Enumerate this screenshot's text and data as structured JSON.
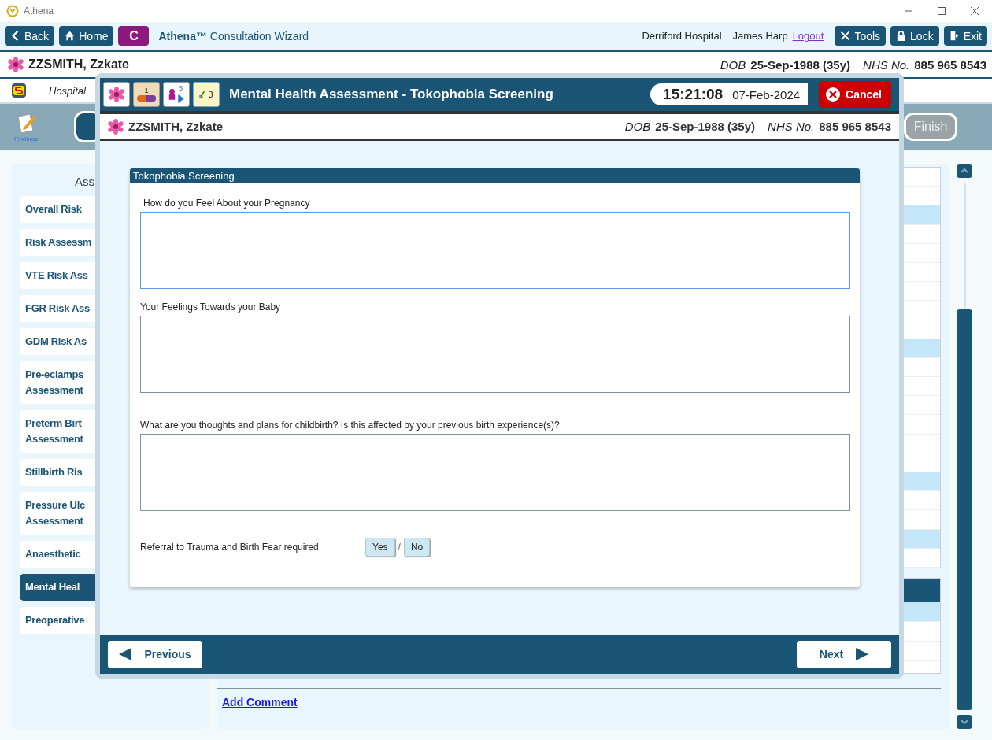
{
  "app": {
    "title": "Athena"
  },
  "toolbar": {
    "back": "Back",
    "home": "Home",
    "c_badge": "C",
    "brand": "Athena™",
    "wizard": "Consultation Wizard",
    "hospital": "Derriford Hospital",
    "user": "James Harp",
    "logout": "Logout",
    "tools": "Tools",
    "lock": "Lock",
    "exit": "Exit"
  },
  "patient": {
    "name": "ZZSMITH, Zzkate",
    "dob_label": "DOB",
    "dob": "25-Sep-1988 (35y)",
    "nhs_label": "NHS No.",
    "nhs": "885 965 8543"
  },
  "banner": {
    "text": "Hospital"
  },
  "action_bar": {
    "findings": "Findings",
    "finish": "Finish"
  },
  "sidebar": {
    "heading": "Ass",
    "items": [
      {
        "lines": [
          "Overall Risk"
        ],
        "selected": false
      },
      {
        "lines": [
          "Risk Assessm"
        ],
        "selected": false
      },
      {
        "lines": [
          "VTE Risk Ass"
        ],
        "selected": false
      },
      {
        "lines": [
          "FGR Risk Ass"
        ],
        "selected": false
      },
      {
        "lines": [
          "GDM Risk As"
        ],
        "selected": false
      },
      {
        "lines": [
          "Pre-eclamps",
          "Assessment"
        ],
        "selected": false
      },
      {
        "lines": [
          "Preterm Birt",
          "Assessment"
        ],
        "selected": false
      },
      {
        "lines": [
          "Stillbirth Ris"
        ],
        "selected": false
      },
      {
        "lines": [
          "Pressure Ulc",
          "Assessment"
        ],
        "selected": false
      },
      {
        "lines": [
          "Anaesthetic"
        ],
        "selected": false
      },
      {
        "lines": [
          "Mental Heal"
        ],
        "selected": true
      },
      {
        "lines": [
          "Preoperative"
        ],
        "selected": false
      }
    ]
  },
  "comment_link": "Add Comment",
  "dialog": {
    "badges": [
      "1",
      "5",
      "3"
    ],
    "title": "Mental Health Assessment - Tokophobia Screening",
    "time": "15:21:08",
    "date": "07-Feb-2024",
    "cancel": "Cancel",
    "patient": {
      "name": "ZZSMITH, Zzkate",
      "dob_label": "DOB",
      "dob": "25-Sep-1988 (35y)",
      "nhs_label": "NHS No.",
      "nhs": "885 965 8543"
    },
    "section": "Tokophobia Screening",
    "questions": [
      {
        "label": "How do you Feel About your Pregnancy",
        "focused": true
      },
      {
        "label": "Your Feelings Towards your Baby",
        "focused": false
      },
      {
        "label": "What are you thoughts and plans for childbirth? Is this affected by your previous birth experience(s)?",
        "focused": false
      }
    ],
    "referral": {
      "label": "Referral to Trauma and Birth Fear required",
      "separator": "/",
      "options": [
        {
          "label": "Yes",
          "selected": false
        },
        {
          "label": "No",
          "selected": false
        }
      ]
    },
    "previous": "Previous",
    "next": "Next"
  }
}
